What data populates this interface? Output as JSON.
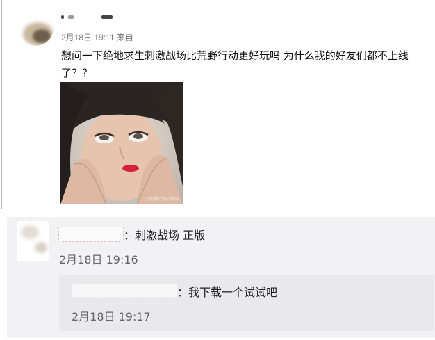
{
  "post": {
    "timestamp": "2月18日 19:11 来自",
    "text": "想问一下绝地求生刺激战场比荒野行动更好玩吗  为什么我的好友们都不上线了？？",
    "image_caption": "◎刺激战场小新闻"
  },
  "comments": [
    {
      "text": "：刺激战场 正版",
      "time": "2月18日 19:16"
    }
  ],
  "reply": {
    "text": "：我下载一个试试吧",
    "time": "2月18日 19:17"
  },
  "colors": {
    "comment_bg": "#f2f2f5",
    "reply_bg": "#e9e9ed",
    "meta_text": "#777777"
  }
}
